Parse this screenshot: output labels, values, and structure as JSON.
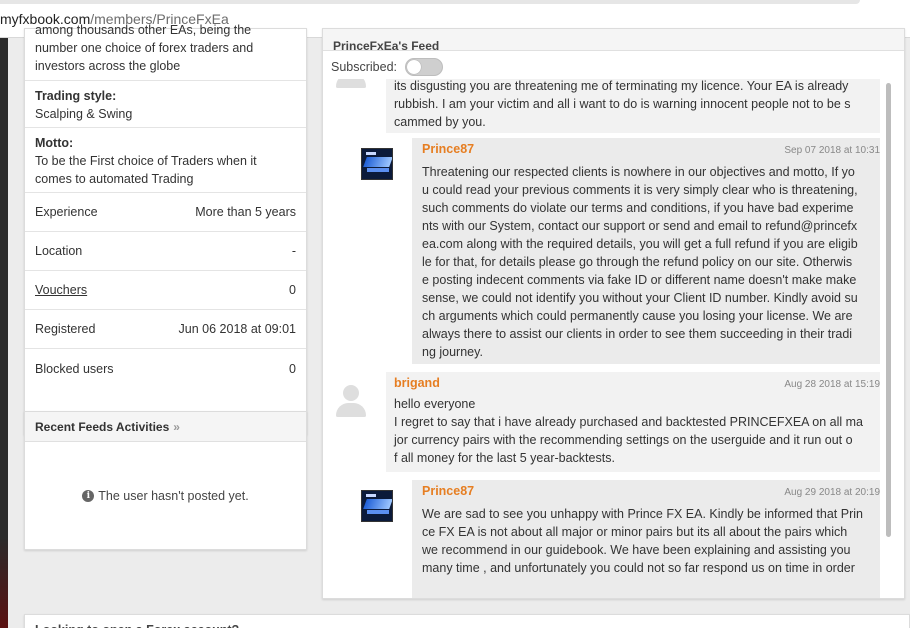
{
  "browser": {
    "url_host": "myfxbook.com",
    "url_path": "/members/PrinceFxEa"
  },
  "profile": {
    "description_tail": "among thousands other EAs, being the number one choice of forex traders and investors across the globe",
    "trading_style_label": "Trading style:",
    "trading_style_value": "Scalping & Swing",
    "motto_label": "Motto:",
    "motto_value": "To be the First choice of Traders when it comes to automated Trading",
    "rows": [
      {
        "label": "Experience",
        "value": "More than 5 years"
      },
      {
        "label": "Location",
        "value": "-"
      },
      {
        "label": "Vouchers",
        "value": "0"
      },
      {
        "label": "Registered",
        "value": "Jun 06 2018 at 09:01"
      },
      {
        "label": "Blocked users",
        "value": "0"
      }
    ]
  },
  "recent_feeds": {
    "title": "Recent Feeds Activities",
    "chevron": "»",
    "empty_text": "The user hasn't posted yet."
  },
  "bottom_box": {
    "title": "Looking to open a Forex account?"
  },
  "feed": {
    "title": "PrinceFxEa's Feed",
    "subscribed_label": "Subscribed:",
    "subscribed": false,
    "comments": [
      {
        "author": "",
        "time": "",
        "text_lines": [
          "its disgusting you are threatening me of terminating my licence. Your EA is already",
          "rubbish. I am your victim and all i want to do is warning innocent people not to be s",
          "cammed by you."
        ]
      },
      {
        "author": "Prince87",
        "time": "Sep 07 2018 at 10:31",
        "text_lines": [
          "Threatening our respected clients is nowhere in our objectives and motto, If yo",
          "u could read your previous comments it is very simply clear who is threatening,",
          "such comments do violate our terms and conditions, if you have bad experime",
          "nts with our System, contact our support or send and email to refund@princefx",
          "ea.com along with the required details, you will get a full refund if you are eligib",
          "le for that, for details please go through the refund policy on our site. Otherwis",
          "e posting indecent comments via fake ID or different name doesn't make make",
          "sense, we could not identify you without your Client ID number. Kindly avoid su",
          "ch arguments which could permanently cause you losing your license. We are",
          "always there to assist our clients in order to see them succeeding in their tradi",
          "ng journey."
        ]
      },
      {
        "author": "brigand",
        "time": "Aug 28 2018 at 15:19",
        "text_lines": [
          "hello everyone",
          "I regret to say that i have already purchased and backtested PRINCEFXEA on all ma",
          "jor currency pairs with the recommending settings on the userguide and it run out o",
          "f all money for the last 5 year-backtests."
        ]
      },
      {
        "author": "Prince87",
        "time": "Aug 29 2018 at 20:19",
        "text_lines": [
          "We are sad to see you unhappy with Prince FX EA. Kindly be informed that Prin",
          "ce FX EA is not about all major or minor pairs but its all about the pairs which",
          "we recommend in our guidebook. We have been explaining and assisting you",
          "many time , and unfortunately you could not so far respond us on time in order"
        ]
      }
    ]
  }
}
